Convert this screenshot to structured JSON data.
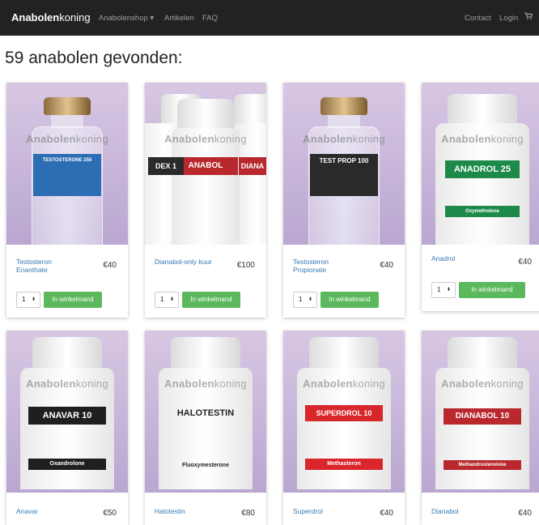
{
  "nav": {
    "brand_bold": "Anabolen",
    "brand_rest": "koning",
    "items": [
      "Anabolenshop ▾",
      "Artikelen",
      "FAQ"
    ],
    "right_items": [
      "Contact",
      "Login"
    ],
    "cart_icon": "cart-icon"
  },
  "heading": "59 anabolen gevonden:",
  "watermark": {
    "bold": "Anabolen",
    "rest": "koning"
  },
  "cart_label": "In winkelmand",
  "products": [
    {
      "name": "Testosteron Enanthate",
      "price": "€40",
      "qty": "1",
      "label": "TESTOSTERONE 250",
      "label_color": "#2d6db3"
    },
    {
      "name": "Dianabol-only kuur",
      "price": "€100",
      "qty": "1",
      "label": "ANABOL",
      "label_color": "#b8282c"
    },
    {
      "name": "Testosteron Propionate",
      "price": "€40",
      "qty": "1",
      "label": "TEST PROP 100",
      "label_color": "#2a2a2a"
    },
    {
      "name": "Anadrol",
      "price": "€40",
      "qty": "1",
      "label": "ANADROL 25",
      "label_color": "#1d8a4a"
    },
    {
      "name": "Anavar",
      "price": "€50",
      "label": "ANAVAR 10",
      "label_color": "#1f1f1f"
    },
    {
      "name": "Halotestin",
      "price": "€80",
      "label": "HALOTESTIN",
      "label_color": "#ffffff"
    },
    {
      "name": "Superdrol",
      "price": "€40",
      "label": "SUPERDROL 10",
      "label_color": "#d9262b"
    },
    {
      "name": "Dianabol",
      "price": "€40",
      "label": "DIANABOL 10",
      "label_color": "#b8282c"
    }
  ]
}
